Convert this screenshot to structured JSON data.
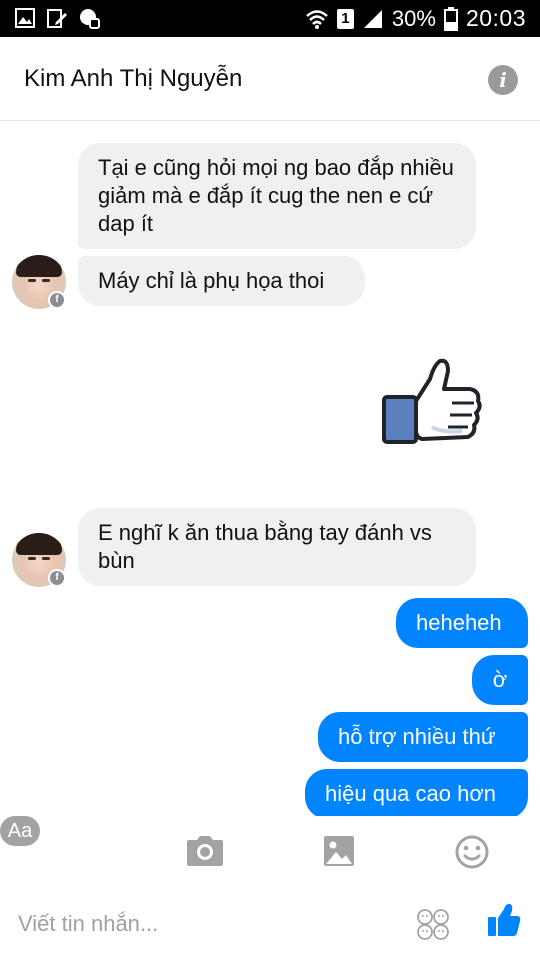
{
  "status_bar": {
    "sim_slot": "1",
    "battery_percent": "30%",
    "time": "20:03"
  },
  "header": {
    "contact_name": "Kim Anh Thị Nguyễn"
  },
  "messages": [
    {
      "from": "contact",
      "text": "Tại e cũng hỏi mọi ng bao đắp nhiều giảm mà e đắp ít cug the nen e cứ dap ít"
    },
    {
      "from": "contact",
      "text": "Máy chỉ là phụ họa thoi"
    },
    {
      "from": "me",
      "type": "like-sticker"
    },
    {
      "from": "contact",
      "text": "E nghĩ k ăn thua bằng tay đánh vs bùn"
    },
    {
      "from": "me",
      "text": "heheheh"
    },
    {
      "from": "me",
      "text": "ờ"
    },
    {
      "from": "me",
      "text": "hỗ trợ nhiều thứ"
    },
    {
      "from": "me",
      "text": "hiệu qua cao hơn"
    }
  ],
  "toolbar": {
    "text_button_label": "Aa"
  },
  "composer": {
    "placeholder": "Viết tin nhắn..."
  },
  "colors": {
    "outgoing_bubble": "#0084ff",
    "incoming_bubble": "#f0f0f0",
    "like_blue": "#0084ff",
    "icon_gray": "#a3a3a3"
  }
}
